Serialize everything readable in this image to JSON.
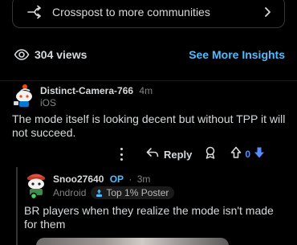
{
  "crosspost": {
    "label": "Crosspost to more communities"
  },
  "stats": {
    "views": "304 views",
    "insights_label": "See More Insights"
  },
  "comment": {
    "username": "Distinct-Camera-766",
    "age": "4m",
    "flair": "iOS",
    "body": "The mode itself is looking decent but without TPP it will not succeed."
  },
  "actions": {
    "reply_label": "Reply",
    "vote_count": "0"
  },
  "reply": {
    "username": "Snoo27640",
    "op_label": "OP",
    "separator": "·",
    "age": "3m",
    "platform": "Android",
    "badge": "Top 1% Poster",
    "body": "BR players when they realize the mode isn't made for them"
  },
  "colors": {
    "accent": "#4fbcff",
    "downvote": "#5a8cff",
    "background": "#000000"
  }
}
